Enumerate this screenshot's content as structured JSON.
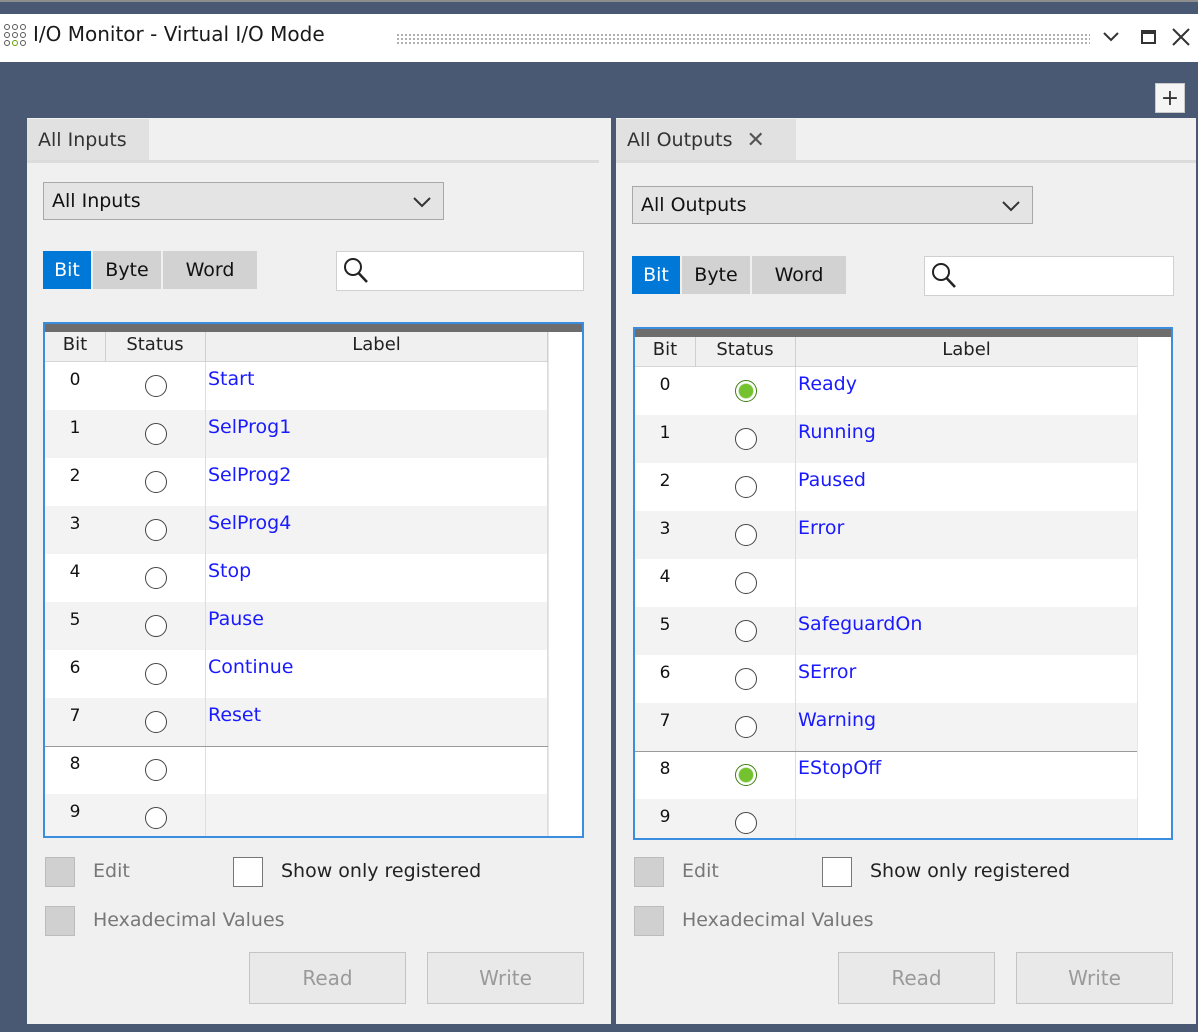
{
  "window": {
    "title": "I/O Monitor - Virtual I/O Mode",
    "controls": {
      "menu_icon": "chevron-down-icon",
      "maximize_icon": "maximize-icon",
      "close_icon": "close-icon"
    },
    "add_pane_label": "+"
  },
  "inputs": {
    "tab_label": "All Inputs",
    "dropdown_value": "All Inputs",
    "modes": [
      "Bit",
      "Byte",
      "Word"
    ],
    "active_mode": "Bit",
    "search_value": "",
    "columns": [
      "Bit",
      "Status",
      "Label"
    ],
    "rows": [
      {
        "bit": "0",
        "on": false,
        "label": "Start"
      },
      {
        "bit": "1",
        "on": false,
        "label": "SelProg1"
      },
      {
        "bit": "2",
        "on": false,
        "label": "SelProg2"
      },
      {
        "bit": "3",
        "on": false,
        "label": "SelProg4"
      },
      {
        "bit": "4",
        "on": false,
        "label": "Stop"
      },
      {
        "bit": "5",
        "on": false,
        "label": "Pause"
      },
      {
        "bit": "6",
        "on": false,
        "label": "Continue"
      },
      {
        "bit": "7",
        "on": false,
        "label": "Reset"
      },
      {
        "bit": "8",
        "on": false,
        "label": ""
      },
      {
        "bit": "9",
        "on": false,
        "label": ""
      }
    ],
    "edit_label": "Edit",
    "show_registered_label": "Show only registered",
    "hex_label": "Hexadecimal Values",
    "read_label": "Read",
    "write_label": "Write"
  },
  "outputs": {
    "tab_label": "All Outputs",
    "tab_close": "✕",
    "dropdown_value": "All Outputs",
    "modes": [
      "Bit",
      "Byte",
      "Word"
    ],
    "active_mode": "Bit",
    "search_value": "",
    "columns": [
      "Bit",
      "Status",
      "Label"
    ],
    "rows": [
      {
        "bit": "0",
        "on": true,
        "label": "Ready"
      },
      {
        "bit": "1",
        "on": false,
        "label": "Running"
      },
      {
        "bit": "2",
        "on": false,
        "label": "Paused"
      },
      {
        "bit": "3",
        "on": false,
        "label": "Error"
      },
      {
        "bit": "4",
        "on": false,
        "label": ""
      },
      {
        "bit": "5",
        "on": false,
        "label": "SafeguardOn"
      },
      {
        "bit": "6",
        "on": false,
        "label": "SError"
      },
      {
        "bit": "7",
        "on": false,
        "label": "Warning"
      },
      {
        "bit": "8",
        "on": true,
        "label": "EStopOff"
      },
      {
        "bit": "9",
        "on": false,
        "label": ""
      }
    ],
    "edit_label": "Edit",
    "show_registered_label": "Show only registered",
    "hex_label": "Hexadecimal Values",
    "read_label": "Read",
    "write_label": "Write"
  },
  "colors": {
    "accent": "#0078d7",
    "led_on": "#74c230",
    "frame": "#4a5973",
    "label_text": "#1a1aff"
  }
}
